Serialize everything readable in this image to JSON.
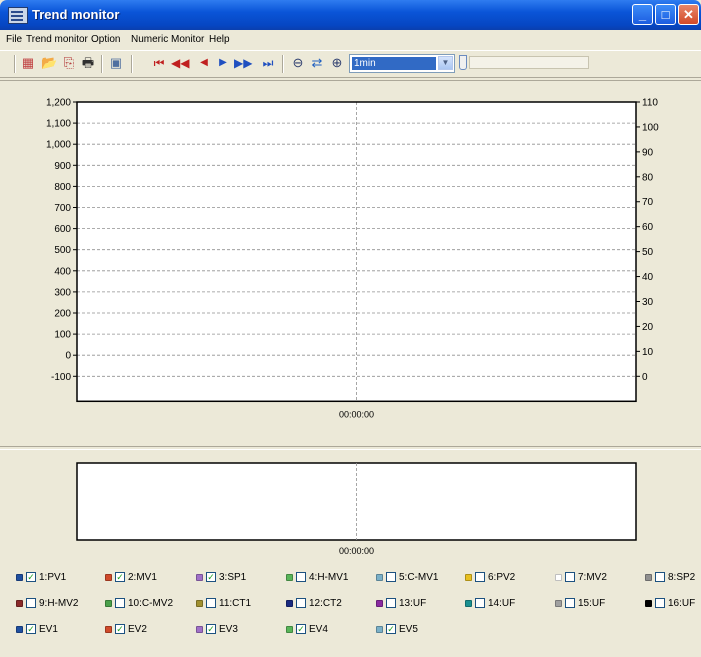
{
  "window": {
    "title": "Trend monitor"
  },
  "menu": [
    "File",
    "Trend monitor",
    "Option",
    "Numeric Monitor",
    "Help"
  ],
  "toolbar": {
    "icons": [
      "chart-settings-icon",
      "open-folder-icon",
      "copy-icon",
      "print-icon",
      "snapshot-icon",
      "first-icon",
      "rewind-icon",
      "step-back-icon",
      "step-forward-icon",
      "fast-forward-icon",
      "last-icon",
      "zoom-out-icon",
      "swap-icon",
      "zoom-in-icon"
    ],
    "time_range": "1min"
  },
  "chart_data": {
    "type": "line",
    "y_left_ticks": [
      "1,200",
      "1,100",
      "1,000",
      "900",
      "800",
      "700",
      "600",
      "500",
      "400",
      "300",
      "200",
      "100",
      "0",
      "-100"
    ],
    "y_right_ticks": [
      "110",
      "100",
      "90",
      "80",
      "70",
      "60",
      "50",
      "40",
      "30",
      "20",
      "10",
      "0"
    ],
    "ylim_left": [
      -100,
      1200
    ],
    "ylim_right": [
      0,
      110
    ],
    "x_ticks": [
      "00:00:00"
    ],
    "mini_x_ticks": [
      "00:00:00"
    ],
    "grid": true,
    "series": []
  },
  "legend": [
    {
      "label": "1:PV1",
      "checked": true,
      "color": "#1f4fa0"
    },
    {
      "label": "2:MV1",
      "checked": true,
      "color": "#d04a2a"
    },
    {
      "label": "3:SP1",
      "checked": true,
      "color": "#a070c8"
    },
    {
      "label": "4:H-MV1",
      "checked": false,
      "color": "#58b558"
    },
    {
      "label": "5:C-MV1",
      "checked": false,
      "color": "#7ab0c8"
    },
    {
      "label": "6:PV2",
      "checked": false,
      "color": "#e8c020"
    },
    {
      "label": "7:MV2",
      "checked": false,
      "color": "#ffffff"
    },
    {
      "label": "8:SP2",
      "checked": false,
      "color": "#909090"
    },
    {
      "label": "9:H-MV2",
      "checked": false,
      "color": "#8a2a2a"
    },
    {
      "label": "10:C-MV2",
      "checked": false,
      "color": "#4aa04a"
    },
    {
      "label": "11:CT1",
      "checked": false,
      "color": "#a09030"
    },
    {
      "label": "12:CT2",
      "checked": false,
      "color": "#1a2a80"
    },
    {
      "label": "13:UF",
      "checked": false,
      "color": "#8a2aa0"
    },
    {
      "label": "14:UF",
      "checked": false,
      "color": "#1a9090"
    },
    {
      "label": "15:UF",
      "checked": false,
      "color": "#a0a0a0"
    },
    {
      "label": "16:UF",
      "checked": false,
      "color": "#000000"
    },
    {
      "label": "EV1",
      "checked": true,
      "color": "#1f4fa0"
    },
    {
      "label": "EV2",
      "checked": true,
      "color": "#d04a2a"
    },
    {
      "label": "EV3",
      "checked": true,
      "color": "#a070c8"
    },
    {
      "label": "EV4",
      "checked": true,
      "color": "#58b558"
    },
    {
      "label": "EV5",
      "checked": true,
      "color": "#7ab0c8"
    }
  ]
}
